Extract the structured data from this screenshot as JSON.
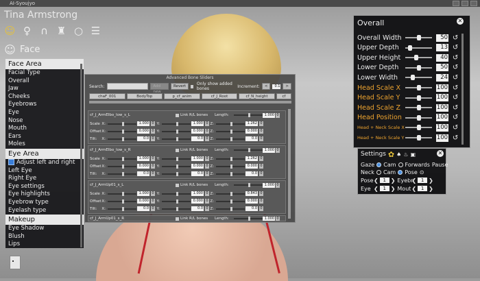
{
  "window": {
    "title": "AI-Syoujyo"
  },
  "character": {
    "name": "Tina Armstrong"
  },
  "top_icons": [
    "face-icon",
    "body-icon",
    "hair-icon",
    "clothes-icon",
    "accessory-icon",
    "list-icon"
  ],
  "face_header": {
    "label": "Face"
  },
  "left_panel": {
    "sections": [
      {
        "title": "Face Area",
        "items": [
          "Facial Type",
          "Overall",
          "Jaw",
          "Cheeks",
          "Eyebrows",
          "Eye",
          "Nose",
          "Mouth",
          "Ears",
          "Moles"
        ]
      },
      {
        "title": "Eye Area",
        "checkbox_item": "Adjust left and right",
        "items": [
          "Left Eye",
          "Right Eye",
          "Eye settings",
          "Eye highlights",
          "Eyebrow type",
          "Eyelash type"
        ]
      },
      {
        "title": "Makeup",
        "items": [
          "Eye Shadow",
          "Blush",
          "Lips"
        ]
      }
    ]
  },
  "abs": {
    "title": "Advanced Bone Sliders",
    "search_label": "Search:",
    "add_new": "Add new",
    "revert": "Revert",
    "only_added": "Only show added bones",
    "increment_label": "Increment:",
    "increment_value": "0.1",
    "tabs": [
      "chaF_001",
      "BodyTop",
      "p_cf_anim",
      "cf_J_Root",
      "cf_N_height",
      "cf"
    ],
    "link_label": "Link R/L bones",
    "length_label": "Length:",
    "row_labels": {
      "scale": "Scale",
      "offset": "Offset",
      "tilt": "Tilt:"
    },
    "axes": {
      "x": "X:",
      "y": "Y:",
      "z": "Z:"
    },
    "bones": [
      {
        "name": "cf_J_ArmElbo_low_s_L",
        "length": "1.000",
        "scale": [
          "1.000",
          "1.000",
          "1.262"
        ],
        "offset": [
          "0.000",
          "0.000",
          "0.000"
        ],
        "tilt": [
          "0.0",
          "0.0",
          "0.0"
        ]
      },
      {
        "name": "cf_J_ArmElbo_low_s_R",
        "length": "1.000",
        "scale": [
          "1.000",
          "1.000",
          "1.262"
        ],
        "offset": [
          "0.000",
          "0.000",
          "0.000"
        ],
        "tilt": [
          "0.0",
          "0.0",
          "0.0"
        ]
      },
      {
        "name": "cf_J_ArmUp01_s_L",
        "length": "1.000",
        "scale": [
          "1.000",
          "1.000",
          "0.843"
        ],
        "offset": [
          "0.000",
          "0.000",
          "0.000"
        ],
        "tilt": [
          "0.0",
          "0.0",
          "0.0"
        ]
      },
      {
        "name": "cf_J_ArmUp01_s_R",
        "length": "1.000"
      }
    ]
  },
  "overall": {
    "title": "Overall",
    "rows": [
      {
        "label": "Overall Width",
        "value": "50",
        "fill": 0.5
      },
      {
        "label": "Upper Depth",
        "value": "13",
        "fill": 0.13
      },
      {
        "label": "Upper Height",
        "value": "40",
        "fill": 0.4
      },
      {
        "label": "Lower Depth",
        "value": "50",
        "fill": 0.5
      },
      {
        "label": "Lower Width",
        "value": "24",
        "fill": 0.24
      },
      {
        "label": "Head Scale X",
        "value": "100",
        "fill": 0.5
      },
      {
        "label": "Head Scale Y",
        "value": "100",
        "fill": 0.5
      },
      {
        "label": "Head Scale Z",
        "value": "100",
        "fill": 0.5
      },
      {
        "label": "Head Position",
        "value": "100",
        "fill": 0.5
      },
      {
        "label": "Head + Neck Scale X",
        "value": "100",
        "fill": 0.5
      },
      {
        "label": "Head + Neck Scale Y",
        "value": "100",
        "fill": 0.5
      }
    ]
  },
  "settings": {
    "title": "Settings",
    "gaze_label": "Gaze",
    "gaze_options": [
      "Cam",
      "Forwards"
    ],
    "pause": "Pause",
    "neck_label": "Neck",
    "neck_options": [
      "Cam",
      "Pose"
    ],
    "pose_label": "Pose",
    "pose_value": "1",
    "eyebr_label": "Eyebr",
    "eyebr_value": "1",
    "eye_label": "Eye",
    "eye_value": "1",
    "mout_label": "Mout",
    "mout_value": "1"
  }
}
